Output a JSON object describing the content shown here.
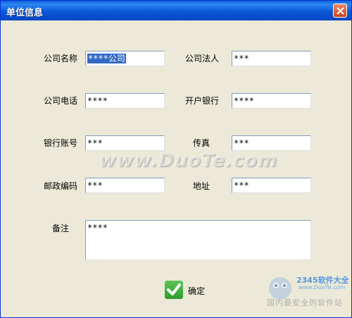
{
  "window": {
    "title": "单位信息"
  },
  "fields": [
    {
      "label": "公司名称",
      "value": "****公司",
      "selected": true
    },
    {
      "label": "公司法人",
      "value": "***"
    },
    {
      "label": "公司电话",
      "value": "****"
    },
    {
      "label": "开户银行",
      "value": "****"
    },
    {
      "label": "银行账号",
      "value": "***"
    },
    {
      "label": "传真",
      "value": "***"
    },
    {
      "label": "邮政编码",
      "value": "***"
    },
    {
      "label": "地址",
      "value": "***"
    }
  ],
  "memo": {
    "label": "备注",
    "value": "****"
  },
  "ok_button": {
    "label": "确定"
  },
  "watermarks": {
    "main": "www.DuoTe.com",
    "brand": "2345软件大全",
    "url": "www.DuoTe.com",
    "tagline": "国内最安全的软件站"
  },
  "colors": {
    "title_bar": "#0a58d6",
    "dialog_bg": "#ece9d8",
    "selection": "#316ac5",
    "check": "#2f9a2b"
  }
}
